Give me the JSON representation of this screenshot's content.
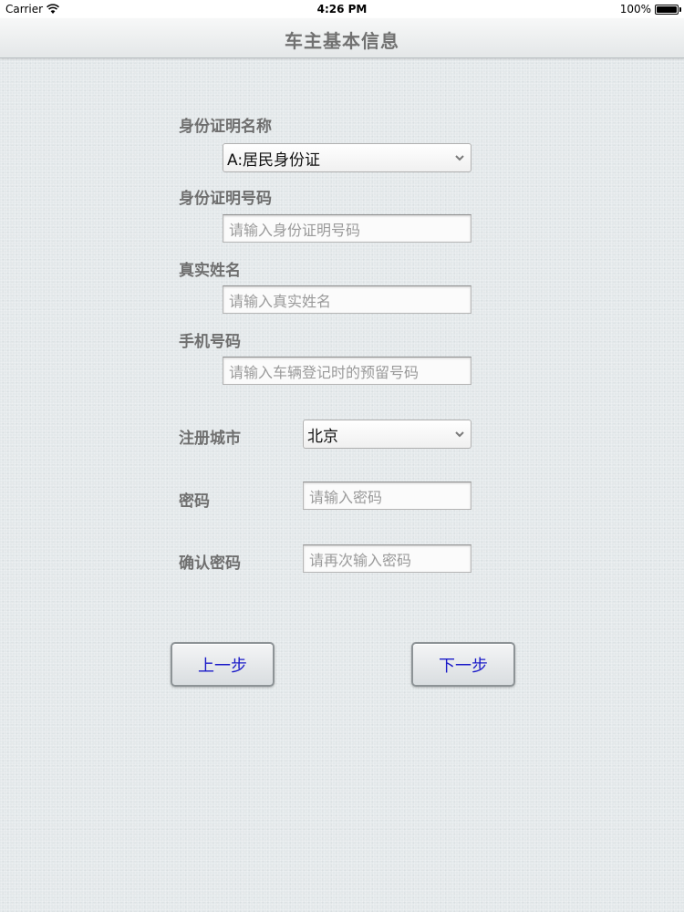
{
  "status_bar": {
    "carrier": "Carrier",
    "time": "4:26 PM",
    "battery": "100%"
  },
  "nav": {
    "title": "车主基本信息"
  },
  "form": {
    "id_type": {
      "label": "身份证明名称",
      "selected": "A:居民身份证"
    },
    "id_number": {
      "label": "身份证明号码",
      "placeholder": "请输入身份证明号码"
    },
    "real_name": {
      "label": "真实姓名",
      "placeholder": "请输入真实姓名"
    },
    "phone": {
      "label": "手机号码",
      "placeholder": "请输入车辆登记时的预留号码"
    },
    "city": {
      "label": "注册城市",
      "selected": "北京"
    },
    "password": {
      "label": "密码",
      "placeholder": "请输入密码"
    },
    "confirm_password": {
      "label": "确认密码",
      "placeholder": "请再次输入密码"
    }
  },
  "buttons": {
    "prev_label": "上一步",
    "next_label": "下一步"
  },
  "colors": {
    "background": "#e3e8ea",
    "button_text": "#1a1ac8",
    "label_text": "#6f6f6f"
  }
}
